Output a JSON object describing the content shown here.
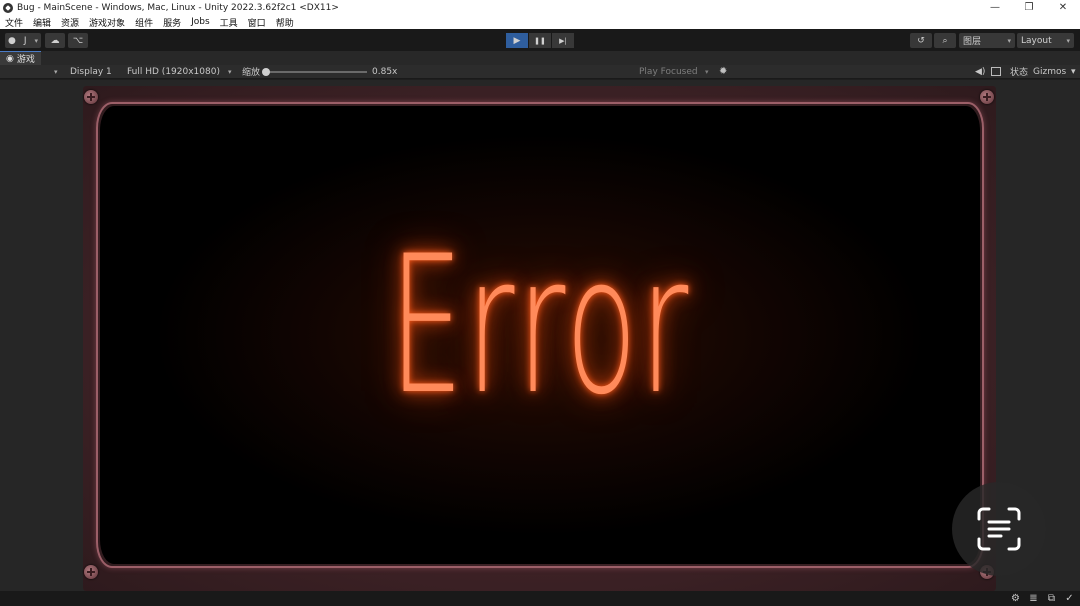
{
  "window": {
    "title": "Bug - MainScene - Windows, Mac, Linux - Unity 2022.3.62f2c1 <DX11>",
    "minimize": "—",
    "restore": "❐",
    "close": "✕"
  },
  "menu": [
    "文件",
    "编辑",
    "资源",
    "游戏对象",
    "组件",
    "服务",
    "Jobs",
    "工具",
    "窗口",
    "帮助"
  ],
  "toolbar": {
    "account_label": "J",
    "account_caret": "▾",
    "cloud_icon": "☁",
    "collab_icon": "⌥",
    "play_icon": "▶",
    "pause_icon": "❚❚",
    "step_icon": "▶|",
    "history_icon": "↺",
    "search_icon": "⌕",
    "layers_label": "图层",
    "layout_label": "Layout",
    "caret": "▾"
  },
  "game_tab": {
    "icon": "👁",
    "label": "游戏"
  },
  "game_toolbar": {
    "display": "Display 1",
    "resolution": "Full HD (1920x1080)",
    "scale_label": "缩放",
    "scale_value": "0.85x",
    "scale_fraction": 0.0,
    "play_mode": "Play Focused",
    "bug_icon": "✹",
    "audio_icon": "◀)",
    "stats": "状态",
    "gizmos": "Gizmos",
    "more": "▾",
    "caret": "▾"
  },
  "game_view": {
    "screen_text": "Error",
    "glow_color": "#ff8a5a"
  },
  "statusbar": {
    "icons": [
      "⚙",
      "≣",
      "⧉",
      "✓"
    ]
  }
}
